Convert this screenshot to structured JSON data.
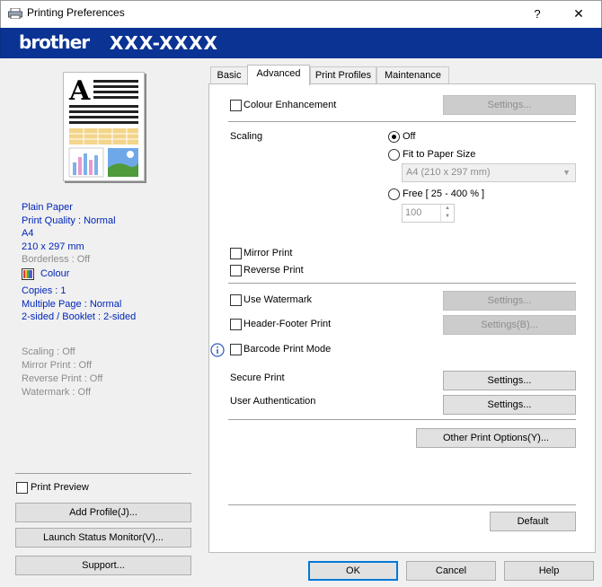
{
  "window": {
    "title": "Printing Preferences",
    "help_label": "?",
    "close_label": "✕"
  },
  "banner": {
    "brand": "brother",
    "model": "XXX-XXXX"
  },
  "summary": {
    "media_type": "Plain Paper",
    "print_quality": "Print Quality : Normal",
    "paper_size": "A4",
    "paper_dims": "210 x 297 mm",
    "borderless": "Borderless : Off",
    "colour": "Colour",
    "copies": "Copies : 1",
    "multiple_page": "Multiple Page : Normal",
    "two_sided": "2-sided / Booklet : 2-sided",
    "scaling": "Scaling : Off",
    "mirror": "Mirror Print : Off",
    "reverse": "Reverse Print : Off",
    "watermark": "Watermark : Off"
  },
  "left_controls": {
    "print_preview": "Print Preview",
    "add_profile": "Add Profile(J)...",
    "launch_status_monitor": "Launch Status Monitor(V)...",
    "support": "Support..."
  },
  "tabs": [
    "Basic",
    "Advanced",
    "Print Profiles",
    "Maintenance"
  ],
  "active_tab": "Advanced",
  "advanced": {
    "colour_enhancement": "Colour Enhancement",
    "colour_enhancement_settings": "Settings...",
    "scaling_label": "Scaling",
    "scaling_options": {
      "off": "Off",
      "fit": "Fit to Paper Size",
      "free": "Free [ 25 - 400 % ]"
    },
    "scaling_selected": "Off",
    "paper_size_value": "A4 (210 x 297 mm)",
    "free_value": "100",
    "mirror_print": "Mirror Print",
    "reverse_print": "Reverse Print",
    "use_watermark": "Use Watermark",
    "watermark_settings": "Settings...",
    "header_footer": "Header-Footer Print",
    "header_footer_settings": "Settings(B)...",
    "barcode_mode": "Barcode Print Mode",
    "secure_print": "Secure Print",
    "secure_print_settings": "Settings...",
    "user_auth": "User Authentication",
    "user_auth_settings": "Settings...",
    "other_options": "Other Print Options(Y)...",
    "default_button": "Default"
  },
  "dialog_buttons": {
    "ok": "OK",
    "cancel": "Cancel",
    "help": "Help"
  },
  "colors": {
    "banner": "#0b3394",
    "summary_text": "#0026b8",
    "accent_focus": "#0078d7"
  }
}
